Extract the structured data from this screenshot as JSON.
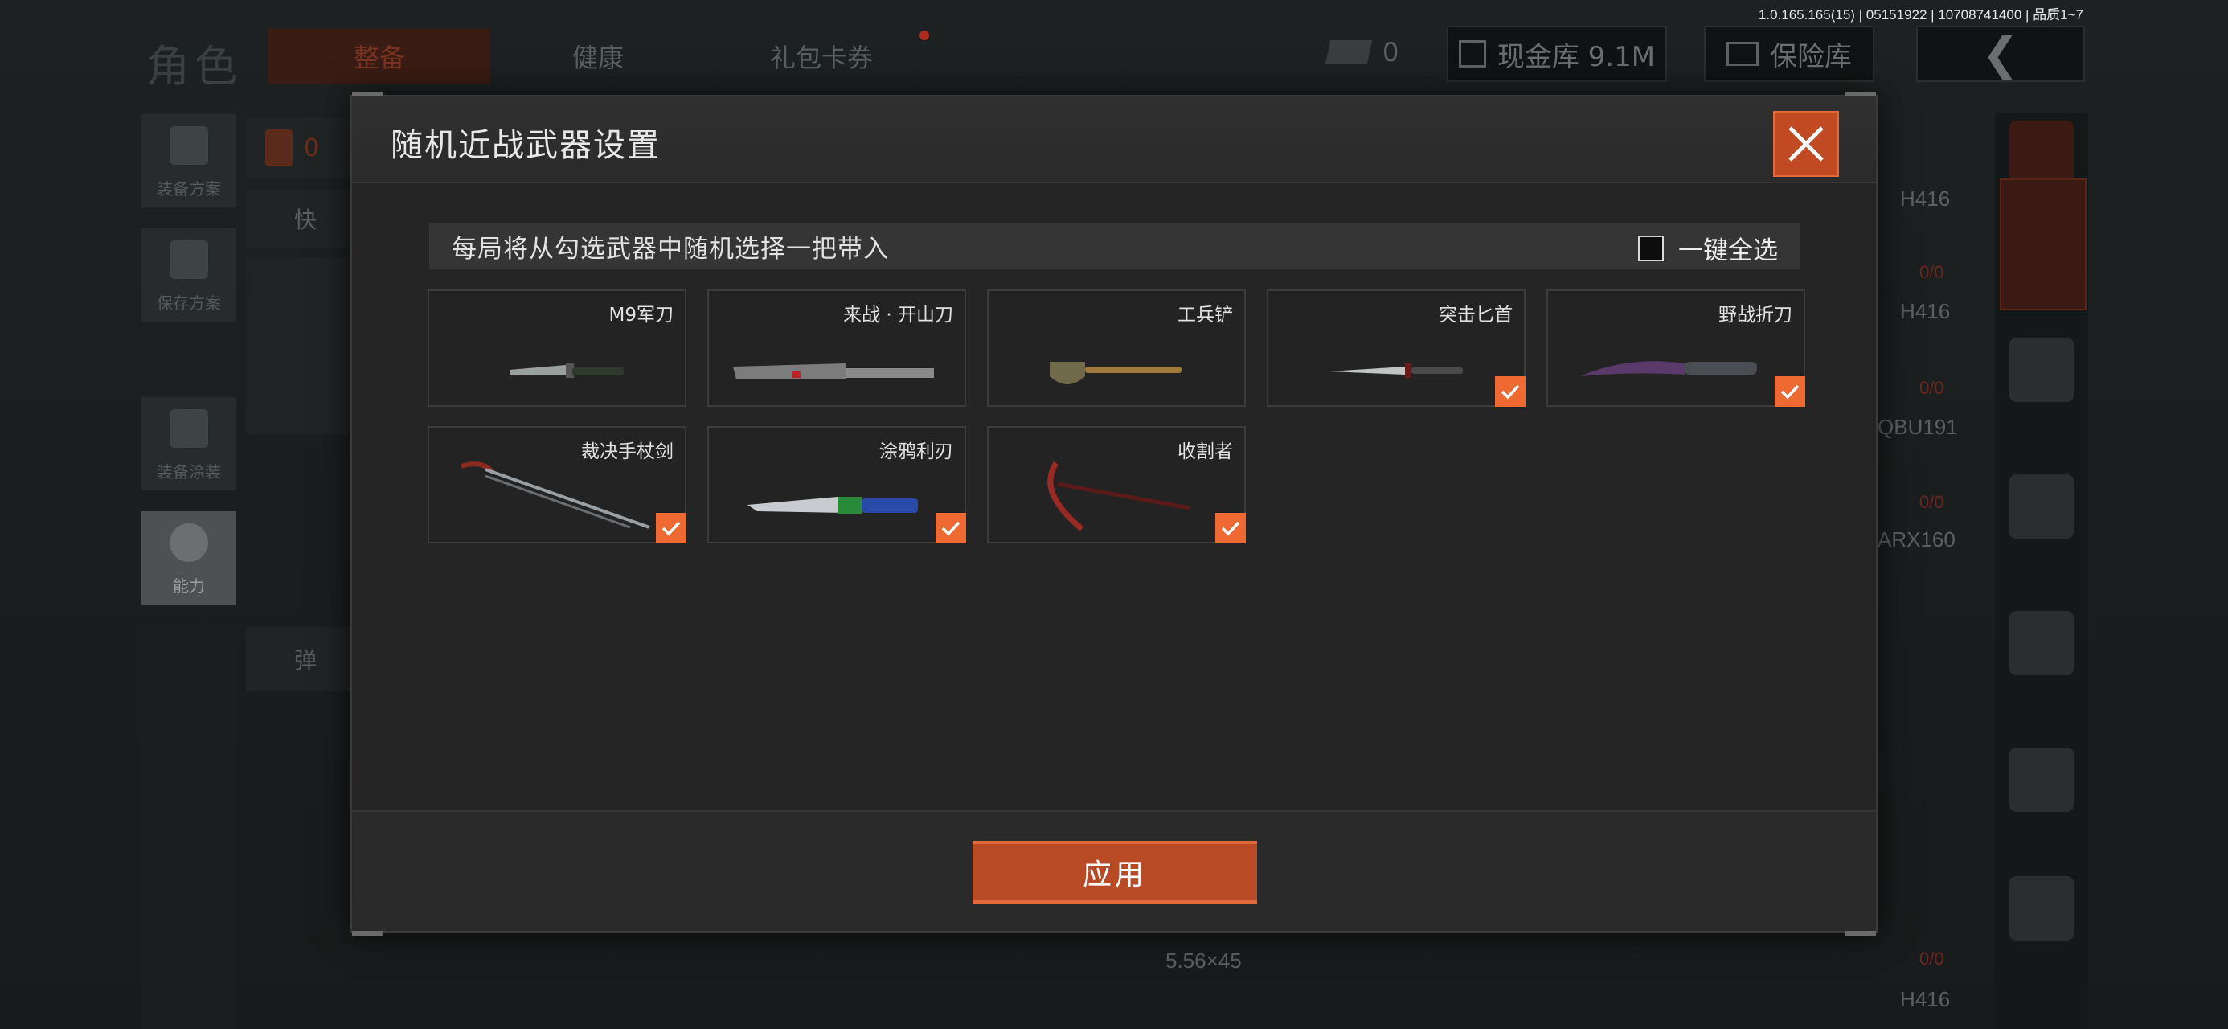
{
  "version_info": "1.0.165.165(15) | 05151922 | 10708741400 | 品质1~7",
  "background": {
    "page_title": "角色",
    "tabs": [
      {
        "label": "整备",
        "active": true
      },
      {
        "label": "健康",
        "active": false
      },
      {
        "label": "礼包卡券",
        "active": false
      }
    ],
    "ticket_count": "0",
    "cash": "现金库 9.1M",
    "safe": "保险库",
    "side_buttons": [
      {
        "label": "装备方案"
      },
      {
        "label": "保存方案"
      },
      {
        "label": "装备涂装"
      },
      {
        "label": "能力"
      }
    ],
    "armor_count": "0",
    "quick_label": "快",
    "ammo_label": "弹",
    "right_list": [
      {
        "name": "H416",
        "count": "0/0"
      },
      {
        "name": "H416",
        "count": "0/0"
      },
      {
        "name": "QBU191",
        "count": "0/0"
      },
      {
        "name": "ARX160",
        "count": ""
      }
    ],
    "ammo_caliber": "5.56×45",
    "bottom_count": "0/0",
    "bottom_gun": "H416"
  },
  "modal": {
    "title": "随机近战武器设置",
    "info_text": "每局将从勾选武器中随机选择一把带入",
    "select_all_label": "一键全选",
    "select_all_checked": false,
    "apply_label": "应用",
    "accent_color": "#ee6a32",
    "weapons": [
      {
        "name": "M9军刀",
        "checked": false,
        "icon": "bayonet-icon"
      },
      {
        "name": "来战 · 开山刀",
        "checked": false,
        "icon": "machete-icon"
      },
      {
        "name": "工兵铲",
        "checked": false,
        "icon": "shovel-icon"
      },
      {
        "name": "突击匕首",
        "checked": true,
        "icon": "dagger-icon"
      },
      {
        "name": "野战折刀",
        "checked": true,
        "icon": "folding-knife-icon"
      },
      {
        "name": "裁决手杖剑",
        "checked": true,
        "icon": "cane-sword-icon"
      },
      {
        "name": "涂鸦利刃",
        "checked": true,
        "icon": "graffiti-blade-icon"
      },
      {
        "name": "收割者",
        "checked": true,
        "icon": "sickle-icon"
      }
    ]
  }
}
